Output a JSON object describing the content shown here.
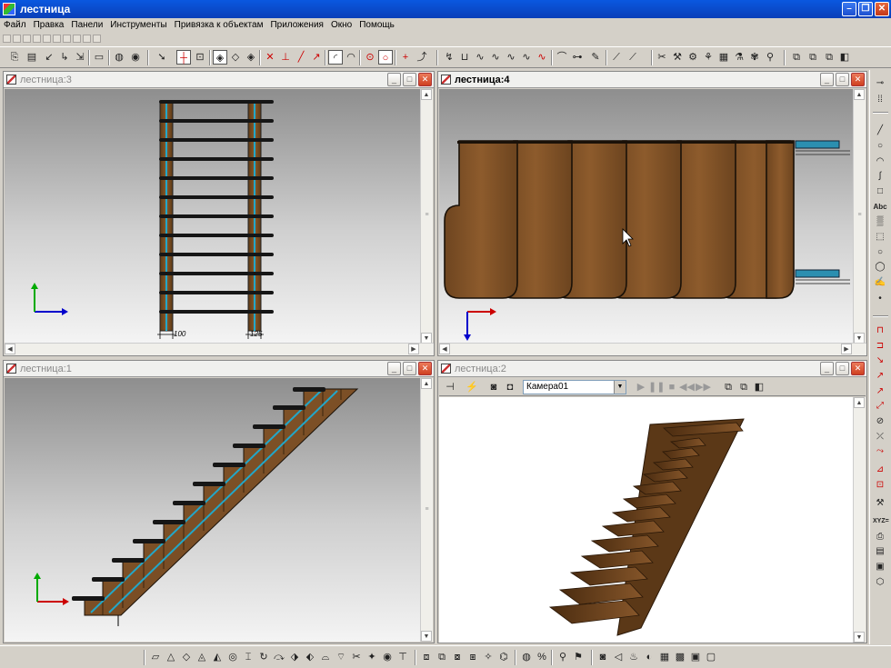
{
  "app": {
    "title": "лестница"
  },
  "menu": [
    "Файл",
    "Правка",
    "Панели",
    "Инструменты",
    "Привязка к объектам",
    "Приложения",
    "Окно",
    "Помощь"
  ],
  "viewports": {
    "top_left": {
      "title": "лестница:3"
    },
    "top_right": {
      "title": "лестница:4"
    },
    "bottom_left": {
      "title": "лестница:1"
    },
    "bottom_right": {
      "title": "лестница:2"
    }
  },
  "dimensions": {
    "left": "100",
    "right": "125"
  },
  "camera": {
    "selected": "Камера01"
  },
  "right_toolbar": {
    "text_tool_label": "Abc",
    "coords_label": "XYZ="
  },
  "colors": {
    "title_bar": "#0a4fcf",
    "wood": "#7a4f22",
    "tread": "#161616",
    "stringer_line": "#22a7c9",
    "axis_x": "#0000cc",
    "axis_y": "#00aa00",
    "axis_z": "#cc0000"
  }
}
